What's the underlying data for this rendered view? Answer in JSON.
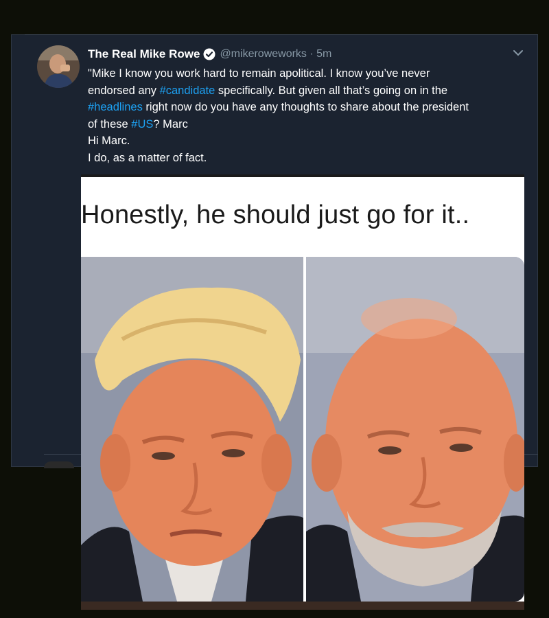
{
  "tweet": {
    "author_name": "The Real Mike Rowe",
    "handle_time": "@mikeroweworks · 5m",
    "verified_icon": "verified-badge-icon",
    "menu_icon": "chevron-down-icon",
    "text_lines": [
      [
        {
          "t": "\"Mike I know you work hard to remain apolitical. I know you’ve never"
        }
      ],
      [
        {
          "t": "endorsed any "
        },
        {
          "t": "#candidate",
          "tag": true
        },
        {
          "t": " specifically. But given all that’s going on in the"
        }
      ],
      [
        {
          "t": "#headlines",
          "tag": true
        },
        {
          "t": " right now do you have any thoughts to share about the president"
        }
      ],
      [
        {
          "t": "of these "
        },
        {
          "t": "#US",
          "tag": true
        },
        {
          "t": "? Marc"
        }
      ],
      [
        {
          "t": "Hi Marc."
        }
      ],
      [
        {
          "t": "I do, as a matter of fact."
        }
      ]
    ]
  },
  "meme": {
    "caption": "Honestly, he should just go for it.."
  },
  "colors": {
    "background": "#0d0f07",
    "panel": "#1b2330",
    "text": "#ffffff",
    "muted": "#8899a6",
    "hashtag": "#1da1f2"
  }
}
